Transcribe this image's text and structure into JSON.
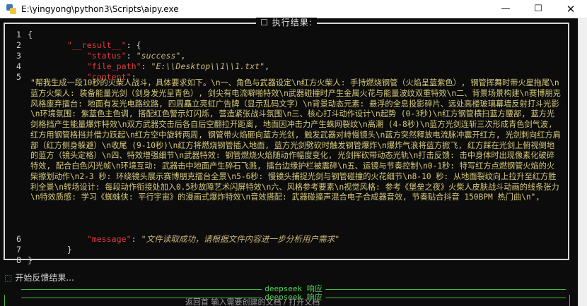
{
  "window": {
    "title": "E:\\yingyong\\python3\\Scripts\\aipy.exe",
    "minimize_glyph": "—",
    "maximize_glyph": "☐",
    "close_glyph": "✕"
  },
  "panel": {
    "title": "☐ 执行结果:"
  },
  "code": {
    "line_numbers": [
      "1",
      "2",
      "3",
      "4",
      "5",
      "6",
      "7",
      "8"
    ],
    "open_brace": "{",
    "result_key": "\"__result__\"",
    "status_key": "\"status\"",
    "status_value": "\"success\"",
    "file_path_key": "\"file_path\"",
    "file_path_value": "\"E:\\\\Desktop\\\\1\\\\1.txt\"",
    "content_key": "\"content\"",
    "content_value": "\"帮我生成一段10秒的火柴人战斗，具体要求如下。\\n一、角色与武器设定\\n红方火柴人: 手持燃烧钢管（火焰呈蓝紫色）, 钢管挥舞时带火星拖尾\\n蓝方火柴人: 装备能量光剑（剑身发光呈青色）, 剑尖有电流噼啪特效\\n武器碰撞时产生金属火花与能量波纹双重特效\\n二、背景场景构建\\n赛博朋克风格废弃擂台: 地面有发光电路纹路, 四周矗立亮虹广告牌（显示乱码文字）\\n背景动态元素: 悬浮的全息投影碎片、远处高楼玻璃幕墙反射打斗光影\\n环境氛围: 紫蓝色主色调, 搭配红色警示灯闪烁, 营造紧张战斗氛围\\n三、核心打斗动作设计\\n起势 (0-3秒)\\n红方钢管横扫蓝方腰部, 蓝方光剑格挡产生能量爆炸特效\\n双方武器交击后各自后空翻拉开距离, 地面因冲击力产生蛛网裂纹\\n高潮 (4-8秒)\\n蓝方光剑连斩三次形成青色剑气波, 红方用钢管格挡并借力跃起\\n红方空中旋转两周, 钢管带火焰砸向蓝方光剑, 触发武器对峙慢镜头\\n蓝方突然释放电流脉冲震开红方, 光剑刺向红方肩部（红方侧身躲避）\\n收尾 (9-10秒)\\n红方将燃烧钢管插入地面, 蓝方光剑劈砍时触发钢管爆炸\\n爆炸气浪将蓝方掀飞, 红方踩在光剑上俯视倒地的蓝方（镜头定格）\\n四、特效增强细节\\n武器特效: 钢管燃烧火焰随动作幅度变化, 光剑挥砍带动态光轨\\n打击反馈: 击中身体时出现像素化破碎特效, 配合白色闪光帧\\n环境互动: 武器击中地面产生碎石飞溅, 擂台边缘护栏被震碎\\n五、运镜与节奏控制\\n0-1秒: 特写红方点燃钢管火焰的火柴擦划动作\\n2-3 秒: 环绕镜头展示赛博朋克擂台全景\\n5-6秒: 慢镜头捕捉光剑与钢管碰撞的火花细节\\n8-10 秒: 从地面裂纹向上拉升至红方胜利全景\\n转场设计: 每段动作衔接处加入0.5秒故障艺术闪屏特效\\n六、风格参考要素\\n视觉风格: 参考《堡垒之夜》火柴人皮肤战斗动画的线条张力\\n特效质感: 学习《蜘蛛侠: 平行宇宙》的漫画式爆炸特效\\n音效搭配: 武器碰撞声混合电子合成器音效, 节奏贴合抖音 150BPM 热门曲\\n\",",
    "message_key": "\"message\"",
    "message_value": "\"文件读取成功，请根据文件内容进一步分析用户需求\"",
    "close_inner": "}",
    "close_outer": "}"
  },
  "feedback": {
    "glyph": "⬚",
    "text": "开始反馈结果..."
  },
  "rules": [
    "deepseek 响应",
    "deepseek 响应"
  ],
  "background_app_text": "返回首  输入需要创建的文档 / 打开文档"
}
